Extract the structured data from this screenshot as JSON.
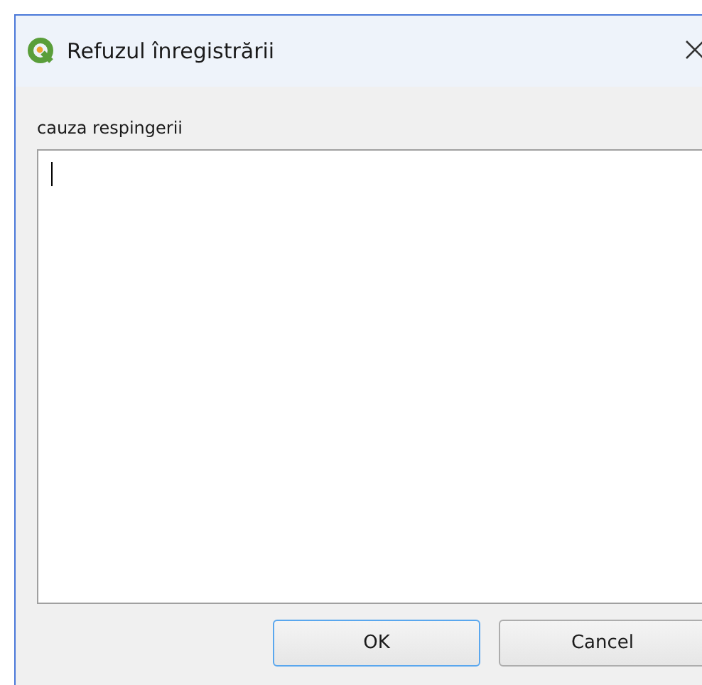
{
  "window": {
    "title": "Refuzul înregistrării"
  },
  "field": {
    "label": "cauza respingerii",
    "focused": true
  },
  "buttons": [
    {
      "label": "OK",
      "default": true
    },
    {
      "label": "Cancel",
      "default": false
    }
  ]
}
